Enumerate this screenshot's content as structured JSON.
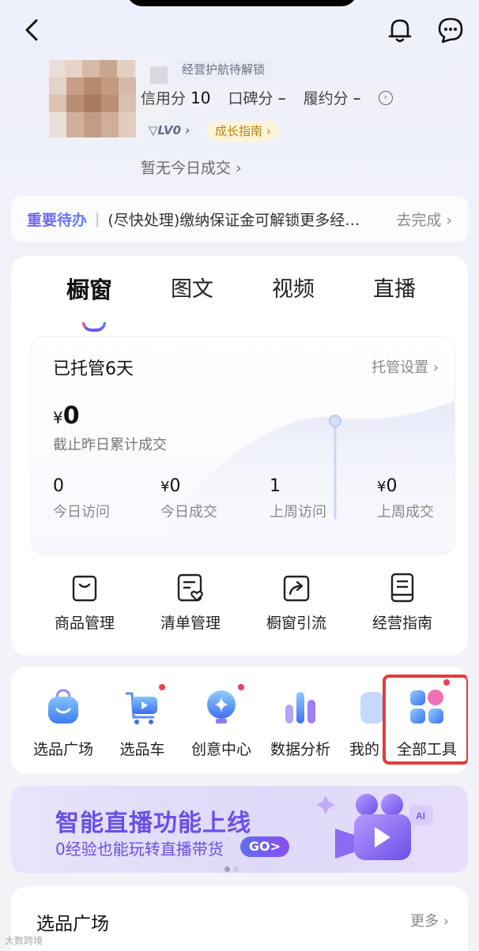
{
  "profile": {
    "unlock_tag": "经营护航待解锁",
    "credit_label": "信用分",
    "credit_value": "10",
    "reputation_label": "口碑分",
    "reputation_value": "–",
    "fulfill_label": "履约分",
    "fulfill_value": "–",
    "level": "LV0",
    "growth_guide": "成长指南",
    "today_deal": "暂无今日成交"
  },
  "todo": {
    "title": "重要待办",
    "text": "(尽快处理)缴纳保证金可解锁更多经…",
    "action": "去完成"
  },
  "tabs": [
    "橱窗",
    "图文",
    "视频",
    "直播"
  ],
  "stats": {
    "title": "已托管6天",
    "setting": "托管设置",
    "currency": "¥",
    "cumulative_value": "0",
    "cumulative_label": "截止昨日累计成交",
    "metrics": [
      {
        "value": "0",
        "currency": "",
        "label": "今日访问"
      },
      {
        "value": "0",
        "currency": "¥",
        "label": "今日成交"
      },
      {
        "value": "1",
        "currency": "",
        "label": "上周访问"
      },
      {
        "value": "0",
        "currency": "¥",
        "label": "上周成交"
      }
    ]
  },
  "shortcuts": [
    "商品管理",
    "清单管理",
    "橱窗引流",
    "经营指南"
  ],
  "tools": [
    {
      "label": "选品广场",
      "dot": false
    },
    {
      "label": "选品车",
      "dot": true
    },
    {
      "label": "创意中心",
      "dot": true
    },
    {
      "label": "数据分析",
      "dot": false
    },
    {
      "label": "我的",
      "dot": false
    },
    {
      "label": "全部工具",
      "dot": true
    }
  ],
  "banner": {
    "title": "智能直播功能上线",
    "subtitle": "0经验也能玩转直播带货",
    "go": "GO>"
  },
  "section": {
    "title": "选品广场",
    "more": "更多"
  },
  "watermark": "大数跨境"
}
